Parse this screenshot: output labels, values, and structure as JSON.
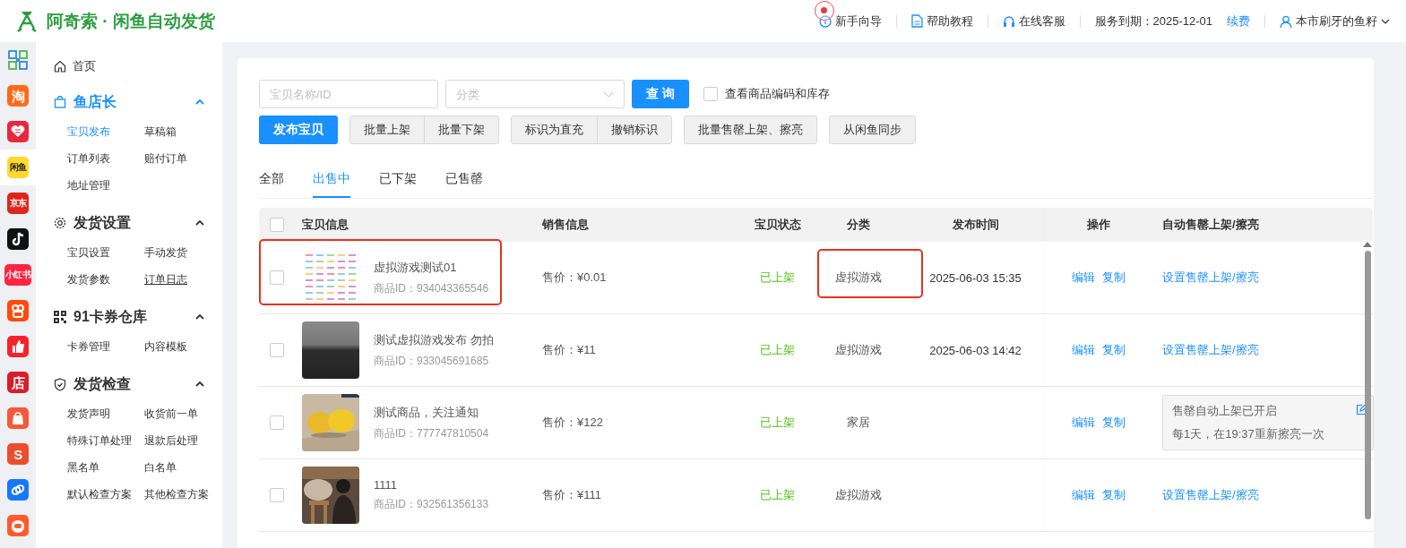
{
  "header": {
    "brand": "阿奇索 · 闲鱼自动发货",
    "links": [
      {
        "kind": "guide",
        "label": "新手向导",
        "badge": true
      },
      {
        "kind": "doc",
        "label": "帮助教程"
      },
      {
        "kind": "support",
        "label": "在线客服"
      }
    ],
    "service": "服务到期：2025-12-01",
    "renew": "续费",
    "user": "本市刷牙的鱼籽"
  },
  "rail": [
    {
      "kind": "grid",
      "color": "#3d8ee8",
      "selected": false
    },
    {
      "kind": "text",
      "label": "淘",
      "color": "#ff6a1a",
      "selected": false
    },
    {
      "kind": "heart",
      "color": "#e8283c",
      "selected": false
    },
    {
      "kind": "text",
      "label": "闲鱼",
      "color": "#ffd92e",
      "selected": true
    },
    {
      "kind": "text",
      "label": "京东",
      "color": "#e1251b",
      "selected": false
    },
    {
      "kind": "note",
      "color": "#111111",
      "selected": false
    },
    {
      "kind": "text",
      "label": "小红书",
      "color": "#ff2442",
      "selected": false
    },
    {
      "kind": "rings",
      "color": "#ff4a0a",
      "selected": false
    },
    {
      "kind": "thumb",
      "color": "#f5222d",
      "selected": false
    },
    {
      "kind": "text",
      "label": "店",
      "color": "#d81e2a",
      "selected": false
    },
    {
      "kind": "bag",
      "color": "#f7583a",
      "selected": false
    },
    {
      "kind": "text",
      "label": "S",
      "color": "#ee4d2d",
      "selected": false
    },
    {
      "kind": "link",
      "color": "#1677ff",
      "selected": false
    },
    {
      "kind": "face",
      "color": "#ff5a2a",
      "selected": false
    }
  ],
  "sidebar": {
    "home": "首页",
    "groups": [
      {
        "title": "鱼店长",
        "active": true,
        "expanded": true,
        "items": [
          {
            "label": "宝贝发布",
            "selected": true,
            "underlined": false
          },
          {
            "label": "草稿箱",
            "selected": false,
            "underlined": false
          },
          {
            "label": "订单列表",
            "selected": false,
            "underlined": false
          },
          {
            "label": "赔付订单",
            "selected": false,
            "underlined": false
          },
          {
            "label": "地址管理",
            "selected": false,
            "underlined": false
          }
        ]
      },
      {
        "title": "发货设置",
        "active": false,
        "expanded": true,
        "items": [
          {
            "label": "宝贝设置",
            "selected": false,
            "underlined": false
          },
          {
            "label": "手动发货",
            "selected": false,
            "underlined": false
          },
          {
            "label": "发货参数",
            "selected": false,
            "underlined": false
          },
          {
            "label": "订单日志",
            "selected": false,
            "underlined": true
          }
        ]
      },
      {
        "title": "91卡券仓库",
        "active": false,
        "expanded": true,
        "items": [
          {
            "label": "卡券管理",
            "selected": false,
            "underlined": false
          },
          {
            "label": "内容模板",
            "selected": false,
            "underlined": false
          }
        ]
      },
      {
        "title": "发货检查",
        "active": false,
        "expanded": true,
        "items": [
          {
            "label": "发货声明",
            "selected": false,
            "underlined": false
          },
          {
            "label": "收货前一单",
            "selected": false,
            "underlined": false
          },
          {
            "label": "特殊订单处理",
            "selected": false,
            "underlined": false
          },
          {
            "label": "退款后处理",
            "selected": false,
            "underlined": false
          },
          {
            "label": "黑名单",
            "selected": false,
            "underlined": false
          },
          {
            "label": "白名单",
            "selected": false,
            "underlined": false
          },
          {
            "label": "默认检查方案",
            "selected": false,
            "underlined": false
          },
          {
            "label": "其他检查方案",
            "selected": false,
            "underlined": false
          }
        ]
      }
    ]
  },
  "filters": {
    "search_placeholder": "宝贝名称/ID",
    "category_placeholder": "分类",
    "query": "查 询",
    "show_codes": {
      "label": "查看商品编码和库存",
      "checked": false
    }
  },
  "actions": [
    [
      "发布宝贝"
    ],
    [
      "批量上架",
      "批量下架"
    ],
    [
      "标识为直充",
      "撤销标识"
    ],
    [
      "批量售罄上架、擦亮"
    ],
    [
      "从闲鱼同步"
    ]
  ],
  "tabs": [
    {
      "label": "全部",
      "selected": false
    },
    {
      "label": "出售中",
      "selected": true
    },
    {
      "label": "已下架",
      "selected": false
    },
    {
      "label": "已售罄",
      "selected": false
    }
  ],
  "table": {
    "select_all": false,
    "columns": [
      "宝贝信息",
      "销售信息",
      "宝贝状态",
      "分类",
      "发布时间",
      "操作",
      "自动售罄上架/擦亮"
    ],
    "rows": [
      {
        "title": "虚拟游戏测试01",
        "id": "商品ID：934043365546",
        "price": "售价：¥0.01",
        "status": "已上架",
        "category": "虚拟游戏",
        "time": "2025-06-03 15:35",
        "ops": [
          "编辑",
          "复制"
        ],
        "auto": {
          "kind": "link",
          "text": "设置售罄上架/擦亮"
        },
        "checked": false,
        "mark_info": true,
        "mark_category": true
      },
      {
        "title": "测试虚拟游戏发布 勿拍",
        "id": "商品ID：933045691685",
        "price": "售价：¥11",
        "status": "已上架",
        "category": "虚拟游戏",
        "time": "2025-06-03 14:42",
        "ops": [
          "编辑",
          "复制"
        ],
        "auto": {
          "kind": "link",
          "text": "设置售罄上架/擦亮"
        },
        "checked": false,
        "mark_info": false,
        "mark_category": false
      },
      {
        "title": "测试商品，关注通知",
        "id": "商品ID：777747810504",
        "price": "售价：¥122",
        "status": "已上架",
        "category": "家居",
        "ops": [
          "编辑",
          "复制"
        ],
        "auto": {
          "kind": "info",
          "lines": [
            "售罄自动上架已开启",
            "每1天，在19:37重新擦亮一次"
          ]
        },
        "checked": false,
        "mark_info": false,
        "mark_category": false
      },
      {
        "title": "1111",
        "id": "商品ID：932561356133",
        "price": "售价：¥111",
        "status": "已上架",
        "category": "虚拟游戏",
        "ops": [
          "编辑",
          "复制"
        ],
        "auto": {
          "kind": "link",
          "text": "设置售罄上架/擦亮"
        },
        "checked": false,
        "mark_info": false,
        "mark_category": false
      }
    ]
  }
}
